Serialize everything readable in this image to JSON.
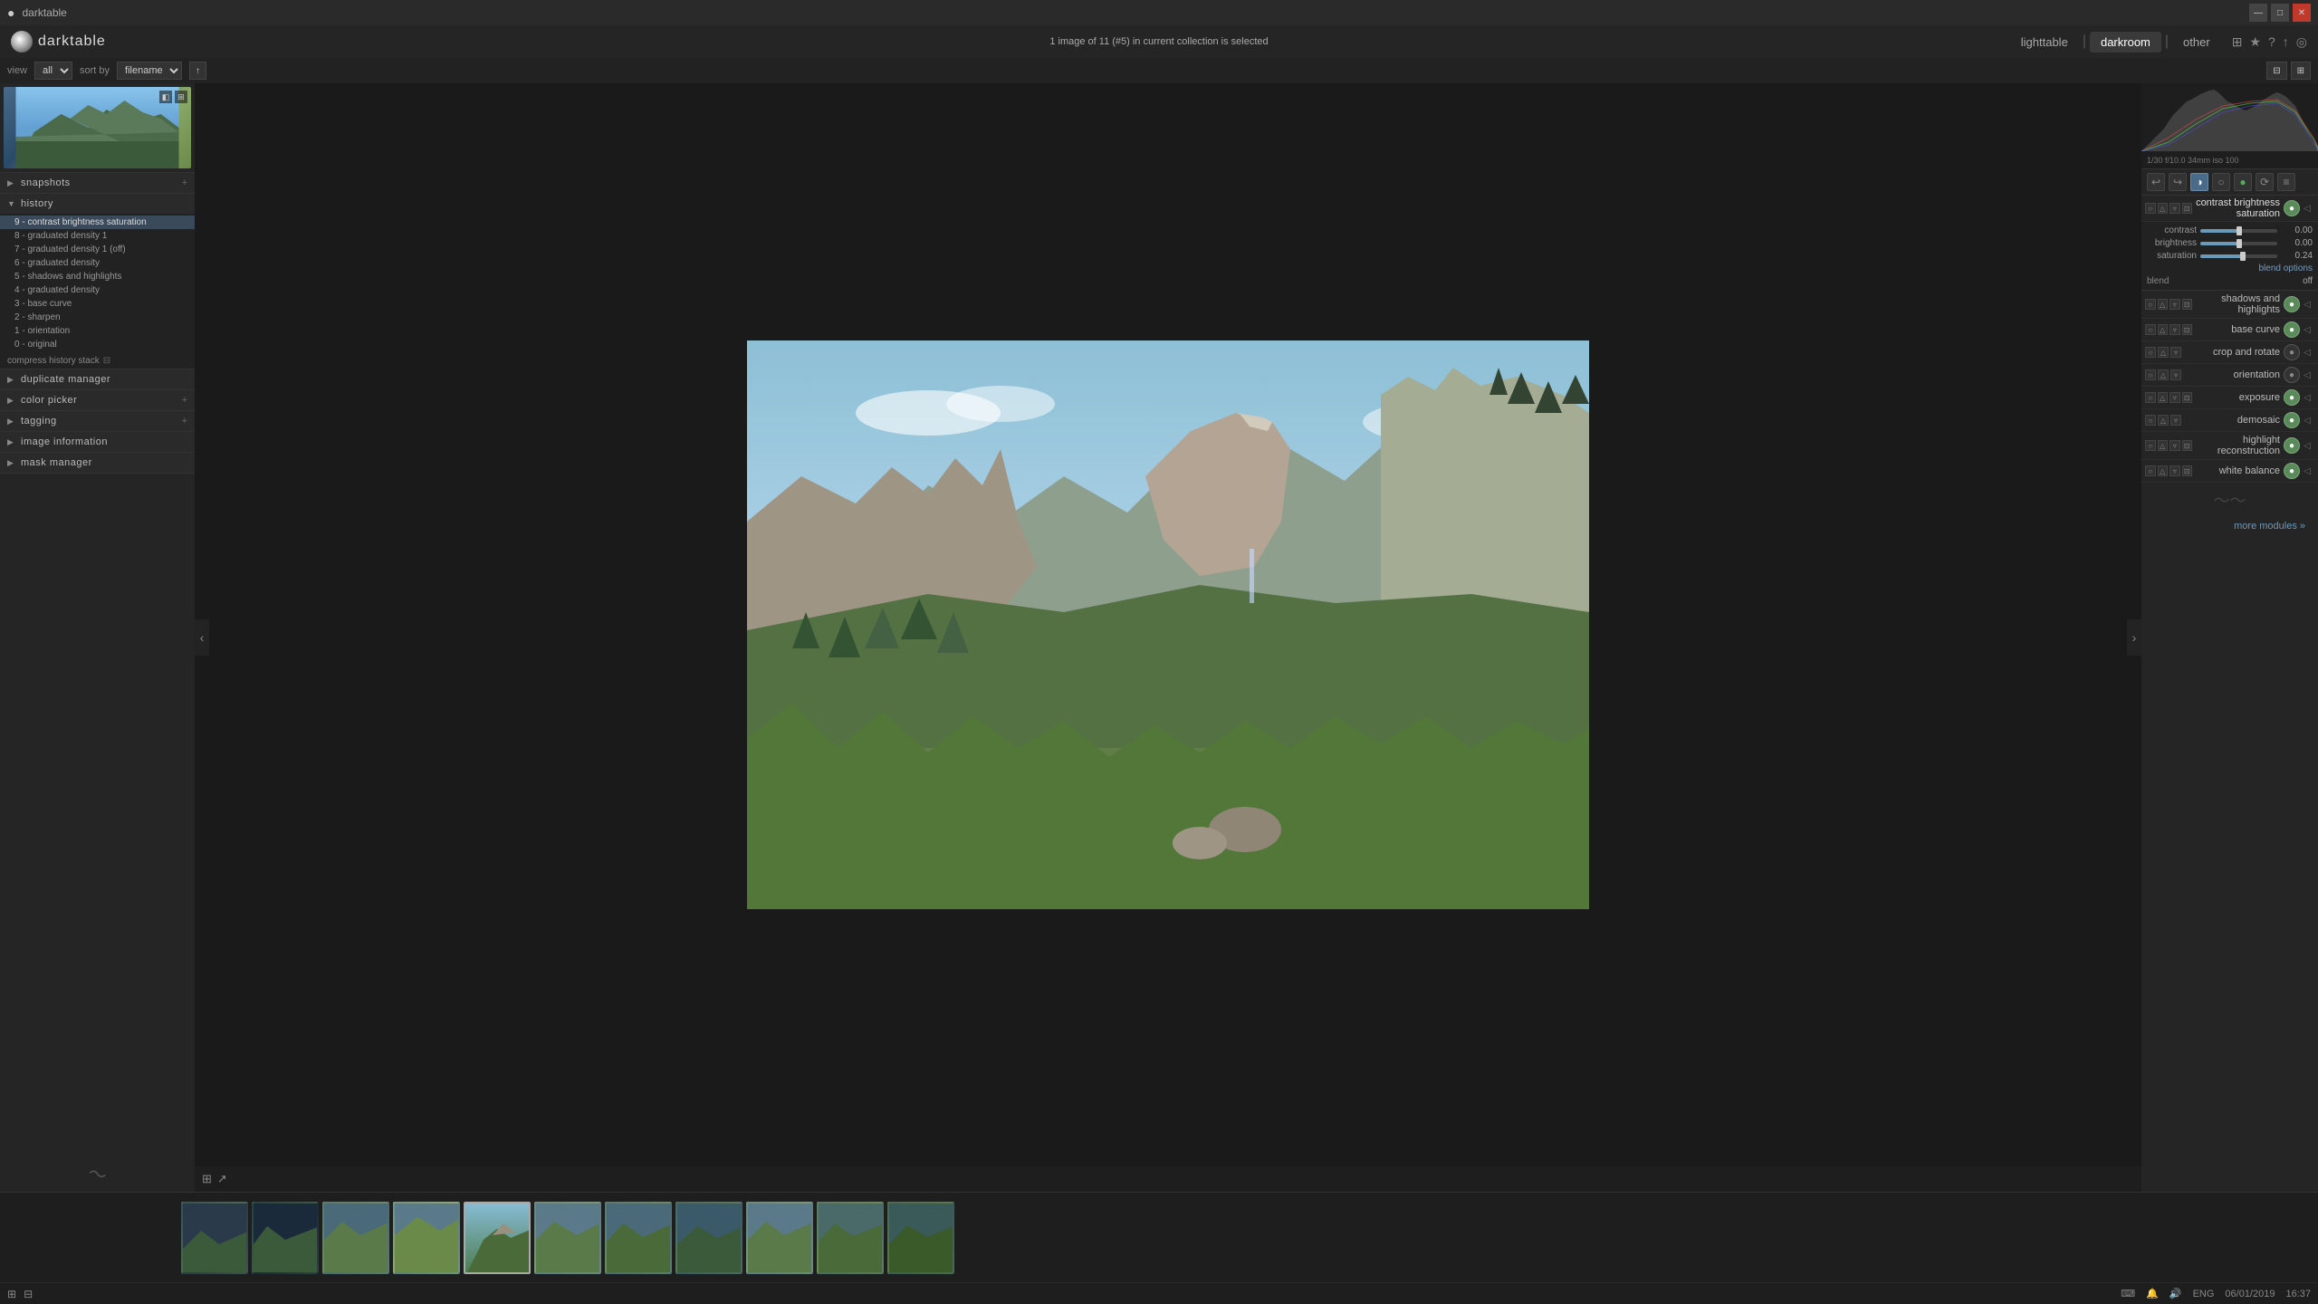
{
  "titlebar": {
    "title": "darktable",
    "minimize_label": "—",
    "maximize_label": "□",
    "close_label": "✕"
  },
  "topbar": {
    "logo_text": "darktable",
    "center_text": "1 image of 11 (#5) in current collection is selected",
    "nav_tabs": [
      {
        "id": "lighttable",
        "label": "lighttable"
      },
      {
        "id": "darkroom",
        "label": "darkroom"
      },
      {
        "id": "other",
        "label": "other"
      }
    ],
    "top_icons": [
      "⊞",
      "★",
      "?",
      "↑",
      "◎"
    ]
  },
  "toolbar": {
    "view_label": "view",
    "view_value": "all",
    "sort_label": "sort by",
    "sort_value": "filename",
    "sort_dir": "↑",
    "icons_right": [
      "⊟",
      "⊞"
    ]
  },
  "left_panel": {
    "snapshots_header": "snapshots",
    "history_header": "history",
    "history_items": [
      {
        "id": 9,
        "label": "9 - contrast brightness saturation",
        "active": true
      },
      {
        "id": 8,
        "label": "8 - graduated density 1"
      },
      {
        "id": 7,
        "label": "7 - graduated density 1 (off)"
      },
      {
        "id": 6,
        "label": "6 - graduated density"
      },
      {
        "id": 5,
        "label": "5 - shadows and highlights"
      },
      {
        "id": 4,
        "label": "4 - graduated density"
      },
      {
        "id": 3,
        "label": "3 - base curve"
      },
      {
        "id": 2,
        "label": "2 - sharpen"
      },
      {
        "id": 1,
        "label": "1 - orientation"
      },
      {
        "id": 0,
        "label": "0 - original"
      }
    ],
    "compress_history": "compress history stack",
    "duplicate_manager": "duplicate manager",
    "color_picker": "color picker",
    "tagging": "tagging",
    "image_information": "image information",
    "mask_manager": "mask manager"
  },
  "right_panel": {
    "histogram_info": "1/30 f/10.0 34mm iso 100",
    "active_module": {
      "name": "contrast brightness saturation",
      "controls": [
        {
          "label": "contrast",
          "value": "0.00",
          "fill_pct": 50
        },
        {
          "label": "brightness",
          "value": "0.00",
          "fill_pct": 50
        },
        {
          "label": "saturation",
          "value": "0.24",
          "fill_pct": 55
        }
      ],
      "blend_options": "blend options",
      "blend_label": "blend",
      "blend_value": "off"
    },
    "modules": [
      {
        "id": "shadows-highlights",
        "name": "shadows and highlights",
        "enabled": true
      },
      {
        "id": "base-curve",
        "name": "base curve",
        "enabled": true
      },
      {
        "id": "crop-rotate",
        "name": "crop and rotate",
        "enabled": false
      },
      {
        "id": "orientation",
        "name": "orientation",
        "enabled": false
      },
      {
        "id": "exposure",
        "name": "exposure",
        "enabled": true
      },
      {
        "id": "demosaic",
        "name": "demosaic",
        "enabled": true
      },
      {
        "id": "highlight-reconstruction",
        "name": "highlight reconstruction",
        "enabled": true
      },
      {
        "id": "white-balance",
        "name": "white balance",
        "enabled": true
      }
    ],
    "more_modules": "more modules »"
  },
  "filmstrip": {
    "thumbs": [
      {
        "id": 1,
        "class": "ft1"
      },
      {
        "id": 2,
        "class": "ft2"
      },
      {
        "id": 3,
        "class": "ft3"
      },
      {
        "id": 4,
        "class": "ft4"
      },
      {
        "id": 5,
        "class": "ft5",
        "active": true
      },
      {
        "id": 6,
        "class": "ft6"
      },
      {
        "id": 7,
        "class": "ft7"
      },
      {
        "id": 8,
        "class": "ft8"
      },
      {
        "id": 9,
        "class": "ft9"
      },
      {
        "id": 10,
        "class": "ft10"
      },
      {
        "id": 11,
        "class": "ft11"
      }
    ]
  },
  "statusbar": {
    "icons": [
      "⊞",
      "⊟"
    ],
    "right_items": [
      "06/01/2019",
      "16:37",
      "ENG"
    ]
  }
}
